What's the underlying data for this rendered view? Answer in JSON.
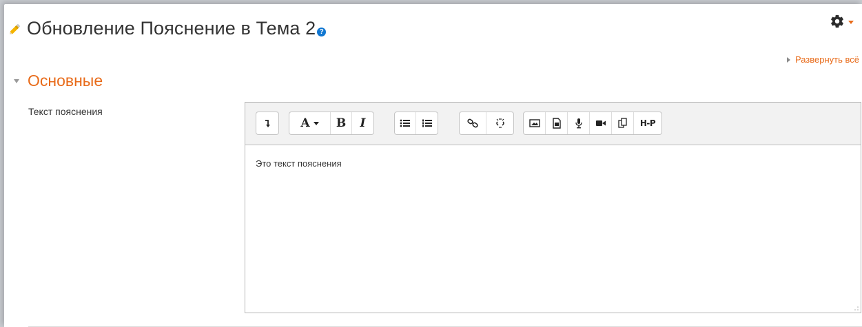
{
  "header": {
    "title": "Обновление Пояснение в Тема 2",
    "help_icon": "question-circle-icon",
    "title_icon": "pencil-icon"
  },
  "actions": {
    "expand_all_label": "Развернуть всё",
    "settings_icon": "gear-icon"
  },
  "section": {
    "title": "Основные"
  },
  "field": {
    "label": "Текст пояснения",
    "value": "Это текст пояснения"
  },
  "toolbar": {
    "groups": [
      [
        "toolbar-toggle-icon"
      ],
      [
        "font-style-icon",
        "bold-icon",
        "italic-icon"
      ],
      [
        "unordered-list-icon",
        "ordered-list-icon"
      ],
      [
        "link-icon",
        "unlink-icon"
      ],
      [
        "image-icon",
        "media-icon",
        "microphone-icon",
        "video-icon",
        "manage-files-icon",
        "h5p-icon"
      ]
    ],
    "font_label": "A",
    "bold_label": "B",
    "italic_label": "I",
    "h5p_label": "H-P"
  },
  "colors": {
    "accent": "#e86b1a",
    "help": "#1177d1",
    "text": "#333333"
  }
}
